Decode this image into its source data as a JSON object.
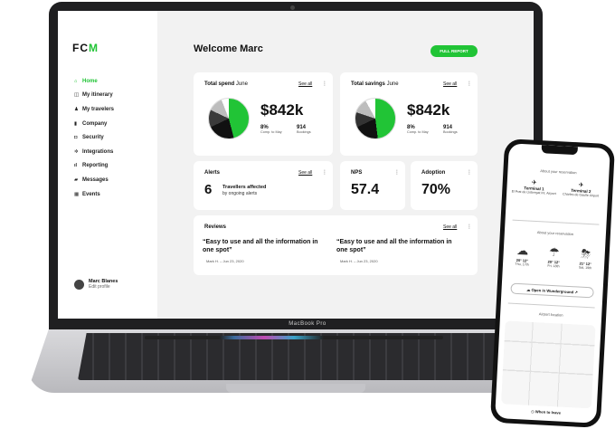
{
  "device": {
    "laptop_label": "MacBook Pro"
  },
  "sidebar": {
    "logo": {
      "prefix": "FC",
      "accent": "M"
    },
    "items": [
      {
        "label": "Home",
        "icon": "home-icon",
        "glyph": "⌂",
        "active": true
      },
      {
        "label": "My itinerary",
        "icon": "itinerary-icon",
        "glyph": "◫"
      },
      {
        "label": "My travelers",
        "icon": "travelers-icon",
        "glyph": "♟"
      },
      {
        "label": "Company",
        "icon": "company-icon",
        "glyph": "▮"
      },
      {
        "label": "Security",
        "icon": "security-icon",
        "glyph": "◘"
      },
      {
        "label": "Integrations",
        "icon": "integrations-icon",
        "glyph": "✲"
      },
      {
        "label": "Reporting",
        "icon": "reporting-icon",
        "glyph": "ıl"
      },
      {
        "label": "Messages",
        "icon": "messages-icon",
        "glyph": "▰"
      },
      {
        "label": "Events",
        "icon": "events-icon",
        "glyph": "▦"
      }
    ],
    "profile": {
      "name": "Marc Blanes",
      "edit": "Edit profile"
    }
  },
  "header": {
    "title": "Welcome Marc",
    "full_report": "FULL REPORT"
  },
  "spend": {
    "title": "Total spend",
    "period": "June",
    "see_all": "See all",
    "value": "$842k",
    "stats": [
      {
        "value": "8%",
        "label": "Comp. to May"
      },
      {
        "value": "914",
        "label": "Bookings"
      }
    ]
  },
  "savings": {
    "title": "Total savings",
    "period": "June",
    "see_all": "See all",
    "value": "$842k",
    "stats": [
      {
        "value": "8%",
        "label": "Comp. to May"
      },
      {
        "value": "914",
        "label": "Bookings"
      }
    ]
  },
  "alerts": {
    "title": "Alerts",
    "see_all": "See all",
    "count": "6",
    "text": "Travellers affected",
    "sub": "by ongoing alerts"
  },
  "nps": {
    "title": "NPS",
    "value": "57.4"
  },
  "adoption": {
    "title": "Adoption",
    "value": "70%"
  },
  "reviews": {
    "title": "Reviews",
    "see_all": "See all",
    "items": [
      {
        "quote": "“Easy to use and all the information in one spot”",
        "by": "Mark H. – Jun 23, 2020"
      },
      {
        "quote": "“Easy to use and all the information in one spot”",
        "by": "Mark H. – Jun 23, 2020"
      }
    ]
  },
  "phone": {
    "reservation_title": "About your reservation",
    "terminals": [
      {
        "name": "Terminal 1",
        "detail": "El Prat de Llobregat Int. Airport",
        "icon": "plane-takeoff-icon"
      },
      {
        "name": "Terminal 2",
        "detail": "Charles de Gaulle Airport",
        "icon": "plane-landing-icon"
      }
    ],
    "weather_title": "About your reservation",
    "weather": [
      {
        "temps": "20° 12°",
        "day": "Thu, 17th",
        "icon": "cloud-icon",
        "glyph": "☁"
      },
      {
        "temps": "20° 12°",
        "day": "Fri, 18th",
        "icon": "rain-icon",
        "glyph": "☂"
      },
      {
        "temps": "21° 12°",
        "day": "Sat, 19th",
        "icon": "storm-icon",
        "glyph": "⛈"
      }
    ],
    "wunderground": "Open in Wunderground",
    "airport_location": "Airport location",
    "when_to_leave": "When to leave"
  },
  "colors": {
    "accent": "#21c436",
    "pie_spend": [
      "#21c436",
      "#111111",
      "#3a3a3a",
      "#bdbdbd",
      "#ffffff"
    ],
    "pie_savings": [
      "#21c436",
      "#111111",
      "#333333",
      "#bdbdbd",
      "#ffffff"
    ]
  }
}
